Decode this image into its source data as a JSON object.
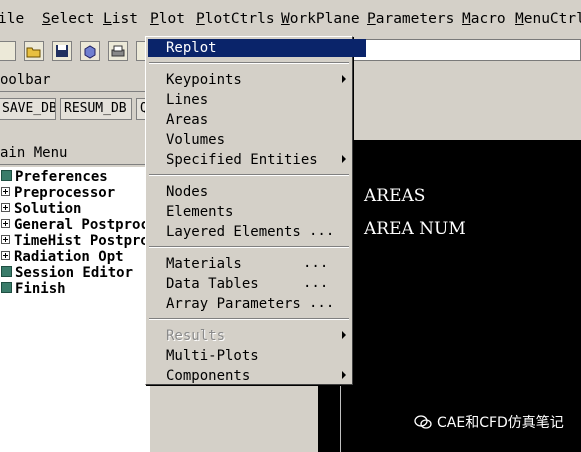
{
  "menubar": {
    "items": [
      {
        "label": "File",
        "shown": "ile",
        "ul": ""
      },
      {
        "label": "Select",
        "ul": "S",
        "rest": "elect"
      },
      {
        "label": "List",
        "ul": "L",
        "rest": "ist"
      },
      {
        "label": "Plot",
        "ul": "P",
        "rest": "lot"
      },
      {
        "label": "PlotCtrls",
        "ul": "P",
        "rest": "lotCtrls"
      },
      {
        "label": "WorkPlane",
        "ul": "W",
        "rest": "orkPlane"
      },
      {
        "label": "Parameters",
        "ul": "P",
        "rest": "arameters"
      },
      {
        "label": "Macro",
        "ul": "M",
        "rest": "acro"
      },
      {
        "label": "MenuCtrls",
        "ul": "M",
        "rest": "enuCtrl"
      }
    ]
  },
  "toolbar": {
    "title": "Toolbar",
    "title_shown": "oolbar",
    "buttons": [
      "SAVE_DB",
      "RESUM_DB",
      "Q"
    ]
  },
  "main_menu": {
    "title": "Main Menu",
    "title_shown": "ain Menu",
    "items": [
      {
        "label": "Preferences",
        "kind": "square"
      },
      {
        "label": "Preprocessor",
        "kind": "plus"
      },
      {
        "label": "Solution",
        "kind": "plus"
      },
      {
        "label": "General Postproc",
        "kind": "plus"
      },
      {
        "label": "TimeHist Postpro",
        "kind": "plus"
      },
      {
        "label": "Radiation Opt",
        "kind": "plus"
      },
      {
        "label": "Session Editor",
        "kind": "square"
      },
      {
        "label": "Finish",
        "kind": "square"
      }
    ]
  },
  "graphics": {
    "line1": "AREAS",
    "line2": "AREA NUM",
    "watermark": "CAE和CFD仿真笔记"
  },
  "plot_menu": {
    "items": [
      {
        "label": "Replot",
        "selected": true
      },
      {
        "label": "Keypoints",
        "submenu": true
      },
      {
        "label": "Lines"
      },
      {
        "label": "Areas"
      },
      {
        "label": "Volumes"
      },
      {
        "label": "Specified Entities",
        "submenu": true
      },
      {
        "label": "Nodes"
      },
      {
        "label": "Elements"
      },
      {
        "label": "Layered Elements",
        "dots": "..."
      },
      {
        "label": "Materials",
        "dots": "..."
      },
      {
        "label": "Data Tables",
        "dots": "..."
      },
      {
        "label": "Array Parameters",
        "dots": "..."
      },
      {
        "label": "Results",
        "submenu": true,
        "disabled": true
      },
      {
        "label": "Multi-Plots"
      },
      {
        "label": "Components",
        "submenu": true
      }
    ]
  },
  "colors": {
    "selection": "#0a246a",
    "graphics_bg": "#000000",
    "chrome": "#d4d0c8"
  }
}
